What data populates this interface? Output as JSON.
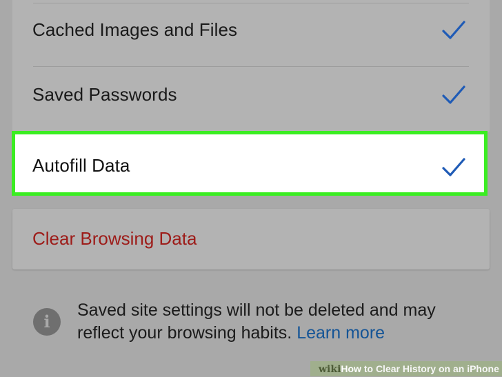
{
  "settings": {
    "rows": [
      {
        "label": "Cached Images and Files",
        "checked": true
      },
      {
        "label": "Saved Passwords",
        "checked": true
      },
      {
        "label": "Autofill Data",
        "checked": true,
        "highlighted": true
      }
    ],
    "checkmark_icon": "checkmark-icon",
    "checkmark_color": "#1f5bb6",
    "highlight_color": "#3bed22"
  },
  "clear_action": {
    "label": "Clear Browsing Data",
    "color": "#9d1c19"
  },
  "footer": {
    "info_icon": "info-icon",
    "info_glyph": "i",
    "message": "Saved site settings will not be deleted and may reflect your browsing habits. ",
    "link_label": "Learn more",
    "link_color": "#145496"
  },
  "watermark": {
    "brand": "wiki",
    "title_start": "How",
    "title_rest": " to Clear History on an iPhone"
  }
}
